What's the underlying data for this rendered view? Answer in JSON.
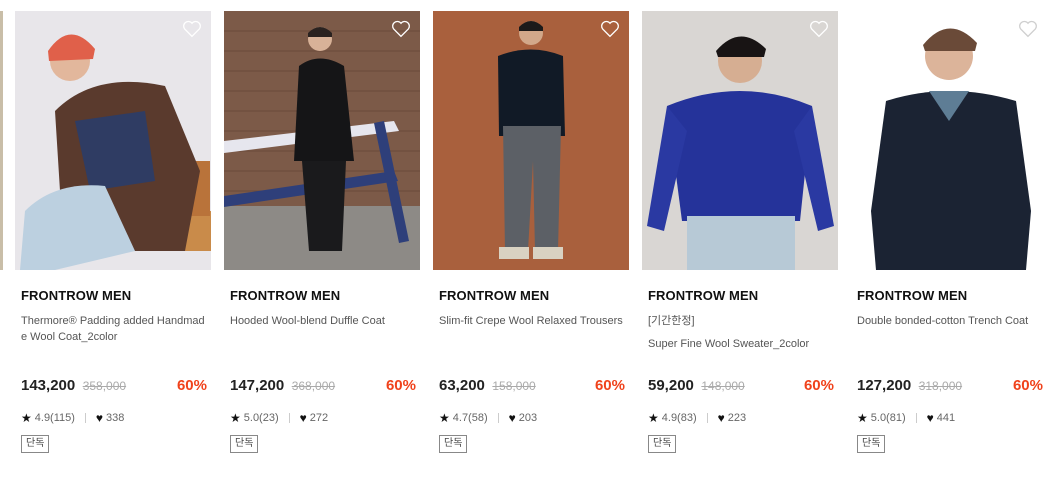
{
  "products": [
    {
      "brand": "FRONTROW MEN",
      "tag": "",
      "name": "Thermore® Padding added Handmade Wool Coat_2color",
      "price": "143,200",
      "original_price": "358,000",
      "discount": "60%",
      "rating": "4.9(115)",
      "likes": "338",
      "badge": "단독",
      "image": "model-brown-coat-red-beanie"
    },
    {
      "brand": "FRONTROW MEN",
      "tag": "",
      "name": "Hooded Wool-blend Duffle Coat",
      "price": "147,200",
      "original_price": "368,000",
      "discount": "60%",
      "rating": "5.0(23)",
      "likes": "272",
      "badge": "단독",
      "image": "model-black-duffle-coat-brick-wall"
    },
    {
      "brand": "FRONTROW MEN",
      "tag": "",
      "name": "Slim-fit Crepe Wool Relaxed Trousers",
      "price": "63,200",
      "original_price": "158,000",
      "discount": "60%",
      "rating": "4.7(58)",
      "likes": "203",
      "badge": "단독",
      "image": "model-grey-trousers-orange-backdrop"
    },
    {
      "brand": "FRONTROW MEN",
      "tag": "[기간한정]",
      "name": "Super Fine Wool Sweater_2color",
      "price": "59,200",
      "original_price": "148,000",
      "discount": "60%",
      "rating": "4.9(83)",
      "likes": "223",
      "badge": "단독",
      "image": "model-navy-sweater"
    },
    {
      "brand": "FRONTROW MEN",
      "tag": "",
      "name": "Double bonded-cotton Trench Coat",
      "price": "127,200",
      "original_price": "318,000",
      "discount": "60%",
      "rating": "5.0(81)",
      "likes": "441",
      "badge": "단독",
      "image": "model-navy-trench-coat"
    }
  ],
  "colors": {
    "discount": "#f0421b",
    "brand_text": "#111111",
    "original_price": "#aaaaaa"
  },
  "icons": {
    "wishlist": "heart-outline-icon",
    "rating": "star-icon",
    "likes": "heart-filled-icon"
  }
}
